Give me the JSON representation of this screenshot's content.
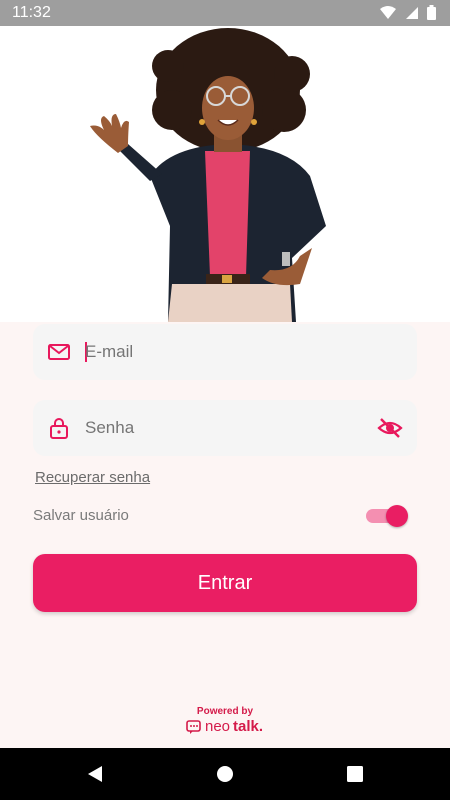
{
  "status_bar": {
    "time": "11:32"
  },
  "login": {
    "email_placeholder": "E-mail",
    "password_placeholder": "Senha",
    "recover_label": "Recuperar senha",
    "save_user_label": "Salvar usuário",
    "save_user_enabled": true,
    "submit_label": "Entrar"
  },
  "footer": {
    "powered_by": "Powered by",
    "brand_neo": "neo",
    "brand_talk": "talk."
  },
  "colors": {
    "accent": "#ea1e63",
    "form_background": "#fdf5f4",
    "field_background": "#f5f5f5",
    "status_bar": "#9e9e9e",
    "nav_bar": "#000000"
  },
  "icons": {
    "email": "mail-icon",
    "password": "lock-icon",
    "visibility": "eye-off-icon",
    "wifi": "wifi-icon",
    "signal": "signal-icon",
    "battery": "battery-icon",
    "back": "back-icon",
    "home": "home-icon",
    "recents": "recents-icon",
    "logo": "chat-bubble-icon"
  }
}
